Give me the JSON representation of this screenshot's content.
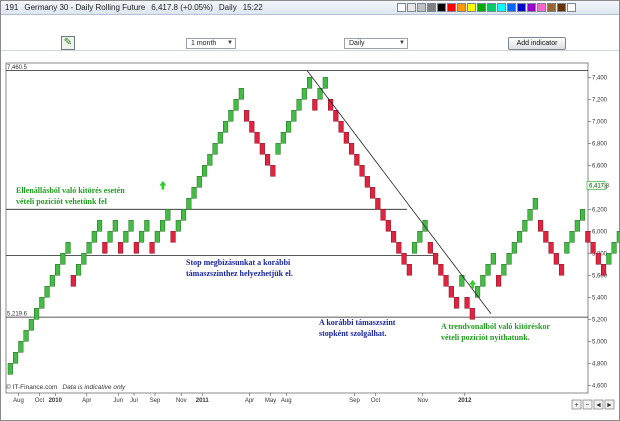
{
  "title_bar": {
    "instrument_code": "191",
    "instrument_name": "Germany 30 - Daily Rolling Future",
    "quote": "6,417.8 (+0.05%)",
    "period": "Daily",
    "time": "15:22"
  },
  "toolbar": {
    "range_select": "1 month",
    "interval_select": "Daily",
    "add_indicator_label": "Add indicator"
  },
  "colors": {
    "up_brick": "#44bb44",
    "down_brick": "#e0233f",
    "support_line": "#222222",
    "trendline": "#222222",
    "green_text": "#1f9c1f",
    "blue_text": "#17259c",
    "swatches": [
      "#ffffff",
      "#e8e8e8",
      "#c0c0c0",
      "#808080",
      "#000000",
      "#ff0000",
      "#ff9900",
      "#ffff00",
      "#00aa00",
      "#00cc66",
      "#00ffff",
      "#0066ff",
      "#0000cc",
      "#9900cc",
      "#ff66cc",
      "#996633",
      "#663300",
      "#ffffff"
    ]
  },
  "icons": {
    "pen_tool": "pen-drawing-icon",
    "nav_icons": [
      "zoom-in-icon",
      "zoom-out-icon",
      "scroll-left-icon",
      "scroll-right-icon"
    ]
  },
  "annotations": {
    "breakout_resistance": [
      "Ellenállásból való kitörés esetén",
      "vételi pozíciót vehetünk fel"
    ],
    "stop_support": [
      "Stop megbízásunkat a korábbi",
      "támaszszinthez helyezhetjük el."
    ],
    "prior_support": [
      "A korábbi támaszszint",
      "stopként szolgálhat."
    ],
    "trendline_breakout": [
      "A trendvonalból való kitöréskor",
      "vételi pozíciót nyithatunk."
    ]
  },
  "footer": {
    "source": "© IT-Finance.com",
    "disclaimer": "Data is indicative only"
  },
  "chart_data": {
    "type": "renko",
    "brick_size": 100,
    "ylim": [
      4600,
      7500
    ],
    "y_ticks": [
      4600,
      4800,
      5000,
      5200,
      5400,
      5600,
      5800,
      6000,
      6200,
      6400,
      6600,
      6800,
      7000,
      7200,
      7400
    ],
    "y_tick_labels": [
      "4,600",
      "4,800",
      "5,000",
      "5,200",
      "5,400",
      "5,600",
      "5,800",
      "6,000",
      "6,200",
      "6,400",
      "6,600",
      "6,800",
      "7,000",
      "7,200",
      "7,400"
    ],
    "x_labels": [
      {
        "label": "Aug",
        "bold": false
      },
      {
        "label": "Oct",
        "bold": false
      },
      {
        "label": "2010",
        "bold": true
      },
      {
        "label": "Apr",
        "bold": false
      },
      {
        "label": "Jun",
        "bold": false
      },
      {
        "label": "Jul",
        "bold": false
      },
      {
        "label": "Sep",
        "bold": false
      },
      {
        "label": "Nov",
        "bold": false
      },
      {
        "label": "2011",
        "bold": true
      },
      {
        "label": "Apr",
        "bold": false
      },
      {
        "label": "May",
        "bold": false
      },
      {
        "label": "Aug",
        "bold": false
      },
      {
        "label": "Sep",
        "bold": false
      },
      {
        "label": "Oct",
        "bold": false
      },
      {
        "label": "Nov",
        "bold": false
      },
      {
        "label": "2012",
        "bold": true
      }
    ],
    "x_label_bricks": [
      2,
      6,
      9,
      15,
      21,
      24,
      28,
      33,
      37,
      46,
      50,
      53,
      66,
      70,
      79,
      87
    ],
    "bricks": [
      {
        "low": 4700,
        "dir": "up"
      },
      {
        "low": 4800,
        "dir": "up"
      },
      {
        "low": 4900,
        "dir": "up"
      },
      {
        "low": 5000,
        "dir": "up"
      },
      {
        "low": 5100,
        "dir": "up"
      },
      {
        "low": 5200,
        "dir": "up"
      },
      {
        "low": 5300,
        "dir": "up"
      },
      {
        "low": 5400,
        "dir": "up"
      },
      {
        "low": 5500,
        "dir": "up"
      },
      {
        "low": 5600,
        "dir": "up"
      },
      {
        "low": 5700,
        "dir": "up"
      },
      {
        "low": 5800,
        "dir": "up"
      },
      {
        "low": 5500,
        "dir": "down"
      },
      {
        "low": 5600,
        "dir": "up"
      },
      {
        "low": 5700,
        "dir": "up"
      },
      {
        "low": 5800,
        "dir": "up"
      },
      {
        "low": 5900,
        "dir": "up"
      },
      {
        "low": 6000,
        "dir": "up"
      },
      {
        "low": 5800,
        "dir": "down"
      },
      {
        "low": 5900,
        "dir": "up"
      },
      {
        "low": 6000,
        "dir": "up"
      },
      {
        "low": 5800,
        "dir": "down"
      },
      {
        "low": 5900,
        "dir": "up"
      },
      {
        "low": 6000,
        "dir": "up"
      },
      {
        "low": 5800,
        "dir": "down"
      },
      {
        "low": 5900,
        "dir": "up"
      },
      {
        "low": 6000,
        "dir": "up"
      },
      {
        "low": 5800,
        "dir": "down"
      },
      {
        "low": 5900,
        "dir": "up"
      },
      {
        "low": 6000,
        "dir": "up"
      },
      {
        "low": 6100,
        "dir": "up"
      },
      {
        "low": 5900,
        "dir": "down"
      },
      {
        "low": 6000,
        "dir": "up"
      },
      {
        "low": 6100,
        "dir": "up"
      },
      {
        "low": 6200,
        "dir": "up"
      },
      {
        "low": 6300,
        "dir": "up"
      },
      {
        "low": 6400,
        "dir": "up"
      },
      {
        "low": 6500,
        "dir": "up"
      },
      {
        "low": 6600,
        "dir": "up"
      },
      {
        "low": 6700,
        "dir": "up"
      },
      {
        "low": 6800,
        "dir": "up"
      },
      {
        "low": 6900,
        "dir": "up"
      },
      {
        "low": 7000,
        "dir": "up"
      },
      {
        "low": 7100,
        "dir": "up"
      },
      {
        "low": 7200,
        "dir": "up"
      },
      {
        "low": 7000,
        "dir": "down"
      },
      {
        "low": 6900,
        "dir": "down"
      },
      {
        "low": 6800,
        "dir": "down"
      },
      {
        "low": 6700,
        "dir": "down"
      },
      {
        "low": 6600,
        "dir": "down"
      },
      {
        "low": 6500,
        "dir": "down"
      },
      {
        "low": 6700,
        "dir": "up"
      },
      {
        "low": 6800,
        "dir": "up"
      },
      {
        "low": 6900,
        "dir": "up"
      },
      {
        "low": 7000,
        "dir": "up"
      },
      {
        "low": 7100,
        "dir": "up"
      },
      {
        "low": 7200,
        "dir": "up"
      },
      {
        "low": 7300,
        "dir": "up"
      },
      {
        "low": 7100,
        "dir": "down"
      },
      {
        "low": 7200,
        "dir": "up"
      },
      {
        "low": 7300,
        "dir": "up"
      },
      {
        "low": 7100,
        "dir": "down"
      },
      {
        "low": 7000,
        "dir": "down"
      },
      {
        "low": 6900,
        "dir": "down"
      },
      {
        "low": 6800,
        "dir": "down"
      },
      {
        "low": 6700,
        "dir": "down"
      },
      {
        "low": 6600,
        "dir": "down"
      },
      {
        "low": 6500,
        "dir": "down"
      },
      {
        "low": 6400,
        "dir": "down"
      },
      {
        "low": 6300,
        "dir": "down"
      },
      {
        "low": 6200,
        "dir": "down"
      },
      {
        "low": 6100,
        "dir": "down"
      },
      {
        "low": 6000,
        "dir": "down"
      },
      {
        "low": 5900,
        "dir": "down"
      },
      {
        "low": 5800,
        "dir": "down"
      },
      {
        "low": 5700,
        "dir": "down"
      },
      {
        "low": 5600,
        "dir": "down"
      },
      {
        "low": 5800,
        "dir": "up"
      },
      {
        "low": 5900,
        "dir": "up"
      },
      {
        "low": 6000,
        "dir": "up"
      },
      {
        "low": 5800,
        "dir": "down"
      },
      {
        "low": 5700,
        "dir": "down"
      },
      {
        "low": 5600,
        "dir": "down"
      },
      {
        "low": 5500,
        "dir": "down"
      },
      {
        "low": 5400,
        "dir": "down"
      },
      {
        "low": 5300,
        "dir": "down"
      },
      {
        "low": 5500,
        "dir": "up"
      },
      {
        "low": 5300,
        "dir": "down"
      },
      {
        "low": 5200,
        "dir": "down"
      },
      {
        "low": 5400,
        "dir": "up"
      },
      {
        "low": 5500,
        "dir": "up"
      },
      {
        "low": 5600,
        "dir": "up"
      },
      {
        "low": 5700,
        "dir": "up"
      },
      {
        "low": 5500,
        "dir": "down"
      },
      {
        "low": 5600,
        "dir": "up"
      },
      {
        "low": 5700,
        "dir": "up"
      },
      {
        "low": 5800,
        "dir": "up"
      },
      {
        "low": 5900,
        "dir": "up"
      },
      {
        "low": 6000,
        "dir": "up"
      },
      {
        "low": 6100,
        "dir": "up"
      },
      {
        "low": 6200,
        "dir": "up"
      },
      {
        "low": 6000,
        "dir": "down"
      },
      {
        "low": 5900,
        "dir": "down"
      },
      {
        "low": 5800,
        "dir": "down"
      },
      {
        "low": 5700,
        "dir": "down"
      },
      {
        "low": 5600,
        "dir": "down"
      },
      {
        "low": 5800,
        "dir": "up"
      },
      {
        "low": 5900,
        "dir": "up"
      },
      {
        "low": 6000,
        "dir": "up"
      },
      {
        "low": 6100,
        "dir": "up"
      },
      {
        "low": 5900,
        "dir": "down"
      },
      {
        "low": 5800,
        "dir": "down"
      },
      {
        "low": 5700,
        "dir": "down"
      },
      {
        "low": 5600,
        "dir": "down"
      },
      {
        "low": 5700,
        "dir": "up"
      },
      {
        "low": 5800,
        "dir": "up"
      },
      {
        "low": 5900,
        "dir": "up"
      },
      {
        "low": 6000,
        "dir": "up"
      },
      {
        "low": 6100,
        "dir": "up"
      },
      {
        "low": 6200,
        "dir": "up"
      },
      {
        "low": 6300,
        "dir": "up"
      }
    ],
    "horizontal_lines": [
      {
        "price": 7460.5,
        "label": "7,460.5",
        "from": "start",
        "to": "end"
      },
      {
        "price": 6200,
        "from": "start",
        "to": 76
      },
      {
        "price": 5780,
        "from": "start",
        "to": 82
      },
      {
        "price": 5219.6,
        "label": "5,219.6",
        "from": "start",
        "to": "end"
      }
    ],
    "current_price": {
      "value": 6417.8,
      "label": "6,417.8"
    },
    "trendline": {
      "from": {
        "brick": 57,
        "price": 7460
      },
      "to": {
        "brick": 92,
        "price": 5250
      }
    },
    "arrows": [
      {
        "brick": 29,
        "price": 6400
      },
      {
        "brick": 88,
        "price": 5500
      }
    ]
  }
}
